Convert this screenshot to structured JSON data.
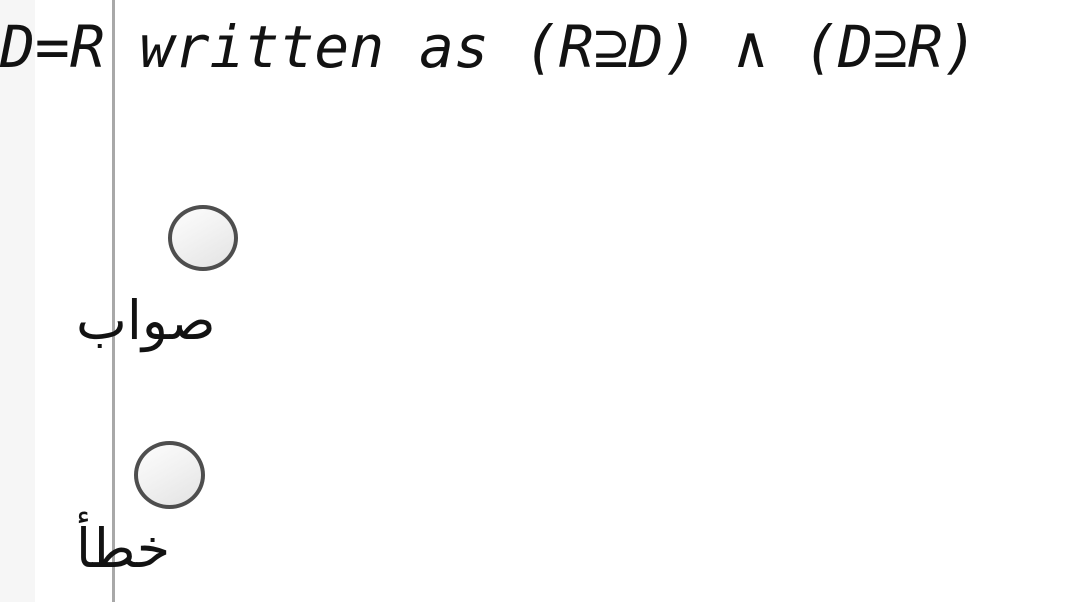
{
  "question": {
    "text": "D=R written as (R⊇D) ∧ (D⊇R)"
  },
  "options": [
    {
      "id": "true",
      "label": "صواب",
      "selected": false,
      "radio_icon": "radio-unchecked-icon"
    },
    {
      "id": "false",
      "label": "خطأ",
      "selected": false,
      "radio_icon": "radio-unchecked-icon"
    }
  ],
  "colors": {
    "page_background": "#ffffff",
    "gutter_background": "#f6f6f6",
    "vertical_rule": "#a8a8a8",
    "text": "#121212",
    "radio_border": "#4e4e4e",
    "radio_fill": "#f2f2f2"
  }
}
